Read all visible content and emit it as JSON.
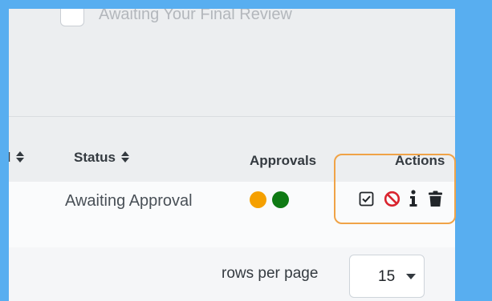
{
  "filter": {
    "checkbox_label": "Awaiting Your Final Review"
  },
  "table": {
    "columns": [
      {
        "label": "d"
      },
      {
        "label": "Status"
      },
      {
        "label": "Approvals"
      },
      {
        "label": "Actions"
      }
    ],
    "row": {
      "status": "Awaiting Approval",
      "approvals": [
        {
          "state": "pending",
          "color": "#f5a000"
        },
        {
          "state": "approved",
          "color": "#0f7a14"
        }
      ],
      "actions": [
        "approve-icon",
        "reject-icon",
        "info-icon",
        "trash-icon"
      ]
    }
  },
  "pagination": {
    "rows_per_page_label": "rows per page",
    "rows_per_page_value": "15"
  },
  "colors": {
    "highlight": "#f0a347",
    "reject": "#d9232e"
  }
}
